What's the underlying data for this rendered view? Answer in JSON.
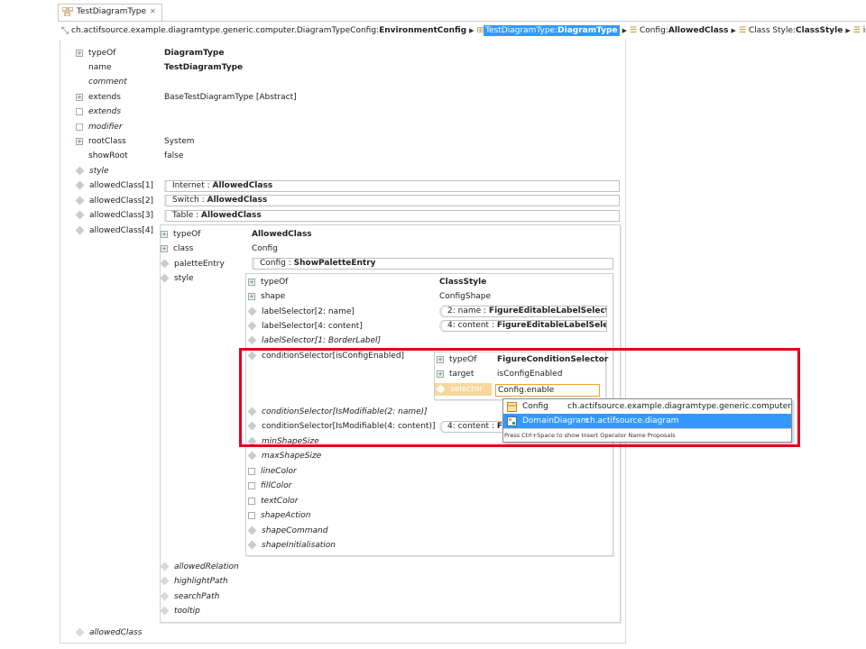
{
  "tab": {
    "title": "TestDiagramType",
    "close": "✕"
  },
  "breadcrumb": {
    "items": [
      {
        "prefix": "ch.actifsource.example.diagramtype.generic.computer.DiagramTypeConfig:",
        "bold": "EnvironmentConfig"
      },
      {
        "prefix": "TestDiagramType:",
        "bold": "DiagramType"
      },
      {
        "prefix": "Config:",
        "bold": "AllowedClass"
      },
      {
        "prefix": "Class Style:",
        "bold": "ClassStyle"
      },
      {
        "prefix": "is",
        "bold": ""
      }
    ]
  },
  "root": {
    "labels": [
      "typeOf",
      "name",
      "comment",
      "extends",
      "extends",
      "modifier",
      "rootClass",
      "showRoot",
      "style",
      "allowedClass[1]",
      "allowedClass[2]",
      "allowedClass[3]",
      "allowedClass[4]"
    ],
    "typeOf": "DiagramType",
    "name": "TestDiagramType",
    "extends": "BaseTestDiagramType [Abstract]",
    "rootClass": "System",
    "showRoot": "false",
    "allowed": [
      {
        "name": "Internet",
        "type": "AllowedClass"
      },
      {
        "name": "Switch",
        "type": "AllowedClass"
      },
      {
        "name": "Table",
        "type": "AllowedClass"
      }
    ],
    "bottom": "allowedClass"
  },
  "ac4": {
    "labels": [
      "typeOf",
      "class",
      "paletteEntry",
      "style"
    ],
    "typeOf": "AllowedClass",
    "class": "Config",
    "palette_name": "Config",
    "palette_type": "ShowPaletteEntry",
    "bottom": [
      "allowedRelation",
      "highlightPath",
      "searchPath",
      "tooltip"
    ]
  },
  "style": {
    "labels": [
      "typeOf",
      "shape",
      "labelSelector[2: name]",
      "labelSelector[4: content]",
      "labelSelector[1: BorderLabel]",
      "conditionSelector[isConfigEnabled]",
      "conditionSelector[IsModifiable(2: name)]",
      "conditionSelector[IsModifiable(4: content)]",
      "minShapeSize",
      "maxShapeSize",
      "lineColor",
      "fillColor",
      "textColor",
      "shapeAction",
      "shapeCommand",
      "shapeInitialisation"
    ],
    "typeOf": "ClassStyle",
    "shape": "ConfigShape",
    "ls2_name": "2: name",
    "ls2_type": "FigureEditableLabelSelector",
    "ls4_name": "4: content",
    "ls4_type": "FigureEditableLabelSelector",
    "cs4_name": "4: content",
    "cs4_type": "F"
  },
  "cond": {
    "labels": [
      "typeOf",
      "target",
      "selector"
    ],
    "typeOf": "FigureConditionSelector",
    "target": "isConfigEnabled",
    "selector": "Config.enable"
  },
  "popup": {
    "items": [
      {
        "name": "Config",
        "path": "ch.actifsource.example.diagramtype.generic.computer"
      },
      {
        "name": "DomainDiagram",
        "path": "ch.actifsource.diagram"
      }
    ],
    "hint": "Press Ctrl+Space to show Insert Operator Name Proposals"
  },
  "colors": {
    "accent": "#3399ff",
    "highlight": "#e0001a"
  }
}
